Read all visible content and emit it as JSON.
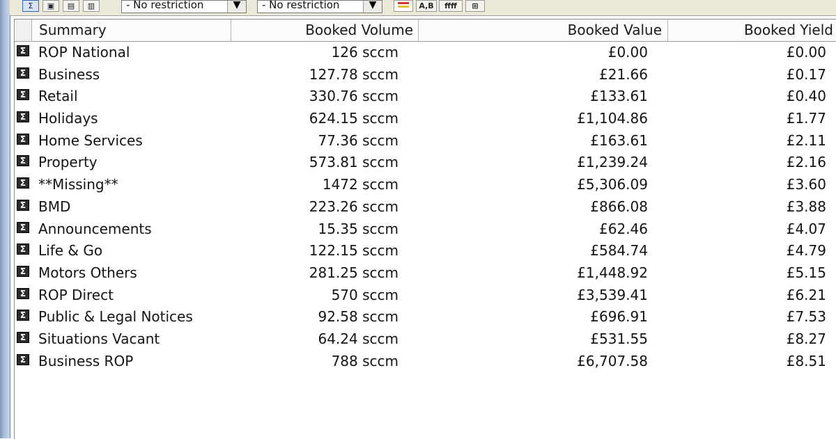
{
  "toolbar": {
    "restriction1": "- No restriction",
    "restriction2": "- No restriction",
    "ab_label": "A,B",
    "ffff_label": "ffff"
  },
  "table": {
    "headers": {
      "summary": "Summary",
      "booked_volume": "Booked Volume",
      "booked_value": "Booked Value",
      "booked_yield": "Booked Yield"
    },
    "rows": [
      {
        "summary": "ROP National",
        "volume": "126 sccm",
        "value": "£0.00",
        "yield": "£0.00"
      },
      {
        "summary": "Business",
        "volume": "127.78 sccm",
        "value": "£21.66",
        "yield": "£0.17"
      },
      {
        "summary": "Retail",
        "volume": "330.76 sccm",
        "value": "£133.61",
        "yield": "£0.40"
      },
      {
        "summary": "Holidays",
        "volume": "624.15 sccm",
        "value": "£1,104.86",
        "yield": "£1.77"
      },
      {
        "summary": "Home Services",
        "volume": "77.36 sccm",
        "value": "£163.61",
        "yield": "£2.11"
      },
      {
        "summary": "Property",
        "volume": "573.81 sccm",
        "value": "£1,239.24",
        "yield": "£2.16"
      },
      {
        "summary": "**Missing**",
        "volume": "1472 sccm",
        "value": "£5,306.09",
        "yield": "£3.60"
      },
      {
        "summary": "BMD",
        "volume": "223.26 sccm",
        "value": "£866.08",
        "yield": "£3.88"
      },
      {
        "summary": "Announcements",
        "volume": "15.35 sccm",
        "value": "£62.46",
        "yield": "£4.07"
      },
      {
        "summary": "Life & Go",
        "volume": "122.15 sccm",
        "value": "£584.74",
        "yield": "£4.79"
      },
      {
        "summary": "Motors Others",
        "volume": "281.25 sccm",
        "value": "£1,448.92",
        "yield": "£5.15"
      },
      {
        "summary": "ROP Direct",
        "volume": "570 sccm",
        "value": "£3,539.41",
        "yield": "£6.21"
      },
      {
        "summary": "Public & Legal Notices",
        "volume": "92.58 sccm",
        "value": "£696.91",
        "yield": "£7.53"
      },
      {
        "summary": "Situations Vacant",
        "volume": "64.24 sccm",
        "value": "£531.55",
        "yield": "£8.27"
      },
      {
        "summary": "Business ROP",
        "volume": "788 sccm",
        "value": "£6,707.58",
        "yield": "£8.51"
      }
    ]
  }
}
